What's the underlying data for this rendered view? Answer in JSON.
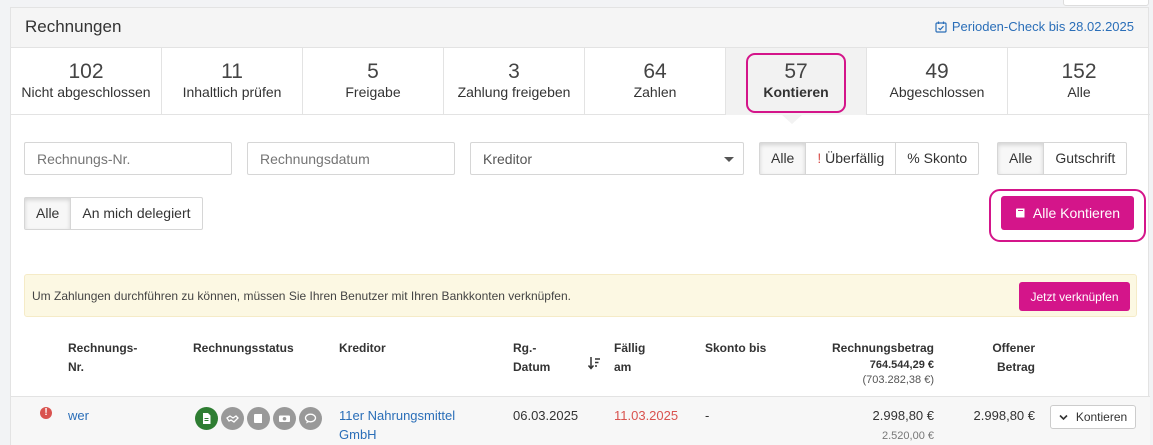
{
  "header": {
    "title": "Rechnungen",
    "period_check": "Perioden-Check bis 28.02.2025"
  },
  "tabs": [
    {
      "count": "102",
      "label": "Nicht abgeschlossen"
    },
    {
      "count": "11",
      "label": "Inhaltlich prüfen"
    },
    {
      "count": "5",
      "label": "Freigabe"
    },
    {
      "count": "3",
      "label": "Zahlung freigeben"
    },
    {
      "count": "64",
      "label": "Zahlen"
    },
    {
      "count": "57",
      "label": "Kontieren",
      "active": true
    },
    {
      "count": "49",
      "label": "Abgeschlossen"
    },
    {
      "count": "152",
      "label": "Alle"
    }
  ],
  "filters": {
    "invoice_no_placeholder": "Rechnungs-Nr.",
    "invoice_date_placeholder": "Rechnungsdatum",
    "creditor_select": "Kreditor",
    "due_group": [
      "Alle",
      "Überfällig",
      "% Skonto"
    ],
    "due_overdue_mark": "!",
    "type_group": [
      "Alle",
      "Gutschrift"
    ],
    "delegation_group": [
      "Alle",
      "An mich delegiert"
    ]
  },
  "actions": {
    "assign_all": "Alle Kontieren"
  },
  "alert": {
    "text": "Um Zahlungen durchführen zu können, müssen Sie Ihren Benutzer mit Ihren Bankkonten verknüpfen.",
    "button": "Jetzt verknüpfen"
  },
  "table": {
    "headers": {
      "invoice_no_1": "Rechnungs-",
      "invoice_no_2": "Nr.",
      "status": "Rechnungsstatus",
      "creditor": "Kreditor",
      "date_1": "Rg.-",
      "date_2": "Datum",
      "due_1": "Fällig",
      "due_2": "am",
      "discount": "Skonto bis",
      "amount": "Rechnungsbetrag",
      "amount_total": "764.544,29 €",
      "amount_total2": "(703.282,38 €)",
      "open_1": "Offener",
      "open_2": "Betrag"
    },
    "rows": [
      {
        "invoice_no": "wer",
        "creditor_1": "11er Nahrungsmittel",
        "creditor_2": "GmbH",
        "date": "06.03.2025",
        "due": "11.03.2025",
        "discount": "-",
        "amount": "2.998,80 €",
        "amount_net": "2.520,00 €",
        "open": "2.998,80 €",
        "action": "Kontieren",
        "status_icons": [
          "document-icon",
          "handshake-icon",
          "book-icon",
          "money-icon",
          "comment-icon"
        ]
      }
    ]
  },
  "colors": {
    "accent": "#d4158a",
    "link": "#2a6eb8",
    "overdue": "#d9534f",
    "alert_bg": "#fcf8e3"
  }
}
